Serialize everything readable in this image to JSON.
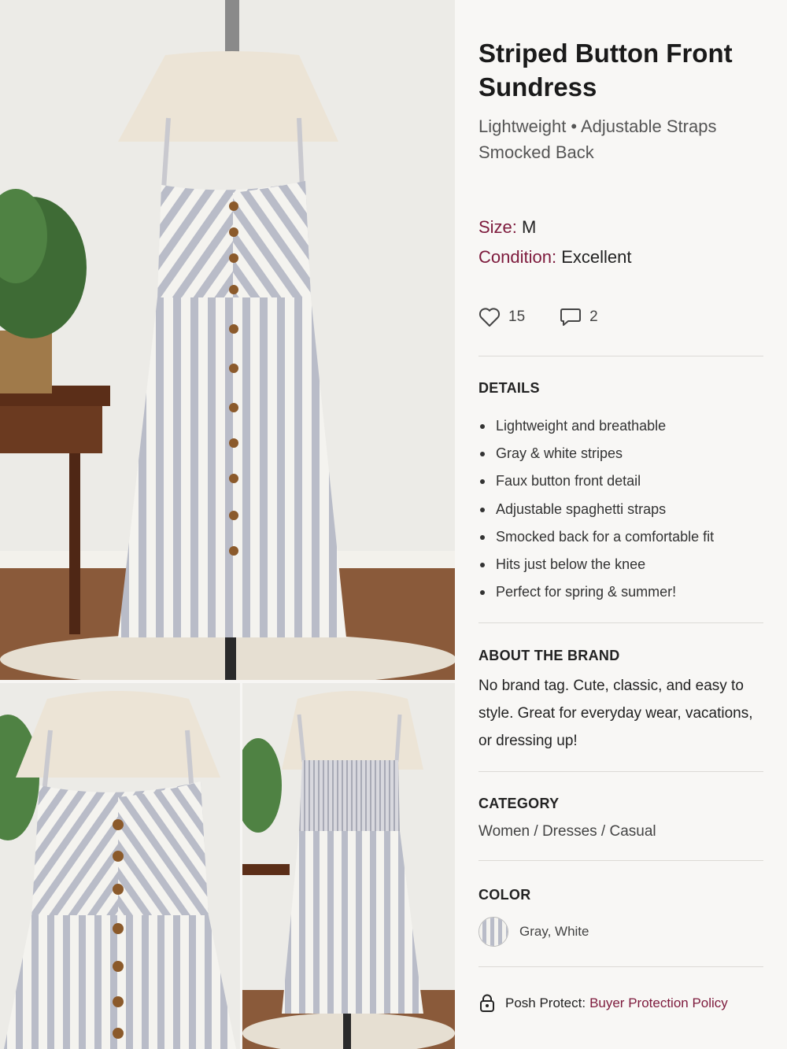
{
  "listing": {
    "title": "Striped Button Front Sundress",
    "subtitle": "Lightweight • Adjustable Straps Smocked Back",
    "size_label": "Size:",
    "size_value": "M",
    "condition_label": "Condition:",
    "condition_value": "Excellent"
  },
  "social": {
    "likes": "15",
    "comments": "2",
    "like_icon": "heart-icon",
    "comment_icon": "comment-icon"
  },
  "details": {
    "heading": "DETAILS",
    "items": [
      "Lightweight and breathable",
      "Gray & white stripes",
      "Faux button front detail",
      "Adjustable spaghetti straps",
      "Smocked back for a comfortable fit",
      "Hits just below the knee",
      "Perfect for spring & summer!"
    ]
  },
  "brand": {
    "heading": "ABOUT THE BRAND",
    "text": "No brand tag. Cute, classic, and easy to style. Great for everyday wear, vacations, or dressing up!"
  },
  "category": {
    "heading": "CATEGORY",
    "path": "Women / Dresses / Casual"
  },
  "color": {
    "heading": "COLOR",
    "value": "Gray, White"
  },
  "protect": {
    "label": "Posh Protect:",
    "link": "Buyer Protection Policy",
    "icon": "shield-lock-icon"
  },
  "colors": {
    "accent": "#7d1a3c",
    "stripe_gray": "#b9bcc8",
    "stripe_white": "#f4f3ef"
  }
}
